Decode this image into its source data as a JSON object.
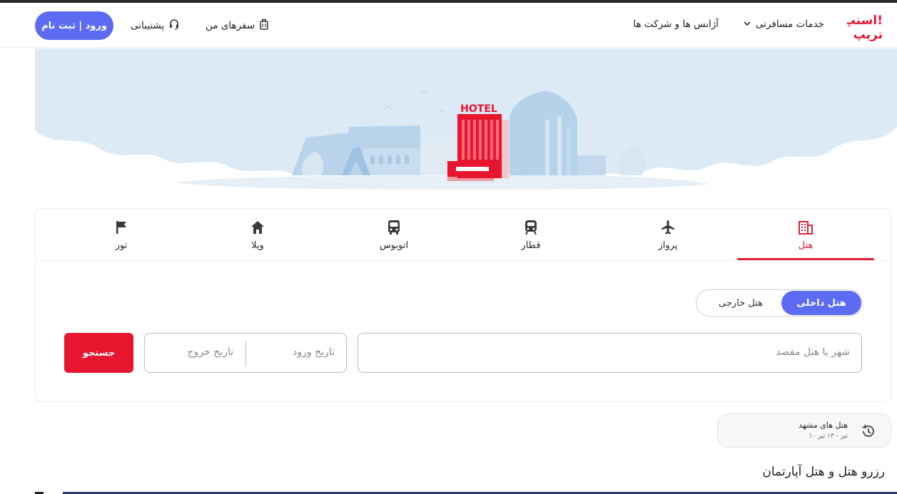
{
  "header": {
    "logo_text": "اسنپ! تریپ",
    "nav": {
      "travel_services": "خدمات مسافرتی",
      "agencies": "آژانس ها و شرکت ها",
      "my_trips": "سفرهای من",
      "support": "پشتیبانی"
    },
    "login_label": "ورود | ثبت نام"
  },
  "hero": {
    "sign_text": "HOTEL"
  },
  "tabs": [
    {
      "label": "هتل",
      "icon": "hotel-icon",
      "active": true
    },
    {
      "label": "پرواز",
      "icon": "airplane-icon",
      "active": false
    },
    {
      "label": "قطار",
      "icon": "train-icon",
      "active": false
    },
    {
      "label": "اتوبوس",
      "icon": "bus-icon",
      "active": false
    },
    {
      "label": "ویلا",
      "icon": "home-icon",
      "active": false
    },
    {
      "label": "تور",
      "icon": "flag-icon",
      "active": false
    }
  ],
  "search": {
    "domestic": "هتل داخلی",
    "foreign": "هتل خارجی",
    "destination_placeholder": "شهر یا هتل مقصد",
    "checkin_placeholder": "تاریخ ورود",
    "checkout_placeholder": "تاریخ خروج",
    "search_label": "جستجو"
  },
  "recent": {
    "title": "هتل های مشهد",
    "dates": "۱۰ تیر - ۱۳ تیر"
  },
  "section_title": "رزرو هتل و هتل آپارتمان",
  "colors": {
    "accent_blue": "#5c6bf2",
    "accent_red": "#e8152e"
  }
}
